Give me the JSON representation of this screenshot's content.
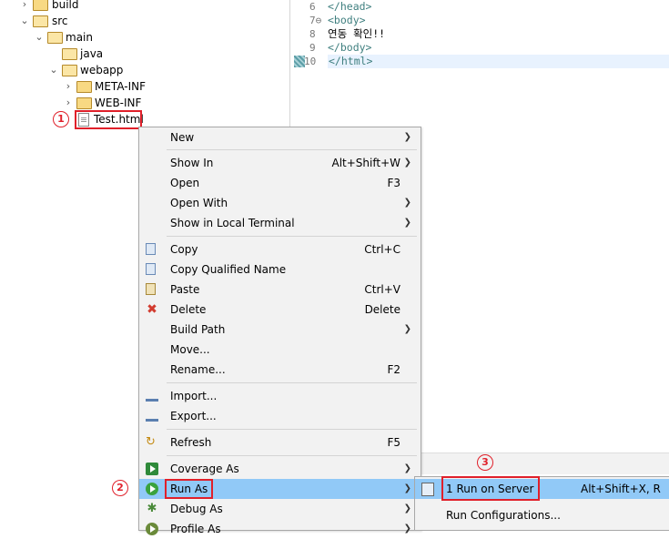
{
  "tree": {
    "items": [
      {
        "label": "build",
        "chevron": "›"
      },
      {
        "label": "src",
        "chevron": "⌄"
      },
      {
        "label": "main",
        "chevron": "⌄"
      },
      {
        "label": "java",
        "chevron": ""
      },
      {
        "label": "webapp",
        "chevron": "⌄"
      },
      {
        "label": "META-INF",
        "chevron": "›"
      },
      {
        "label": "WEB-INF",
        "chevron": "›"
      },
      {
        "label": "Test.html",
        "chevron": ""
      }
    ]
  },
  "editor": {
    "lines": [
      {
        "num": "6",
        "code": "</head>"
      },
      {
        "num": "7⊖",
        "code": "<body>"
      },
      {
        "num": "8",
        "code": "연동 확인!!"
      },
      {
        "num": "9",
        "code": "</body>"
      },
      {
        "num": "10",
        "code": "</html>"
      }
    ]
  },
  "menu": {
    "new": "New",
    "show_in": "Show In",
    "show_in_acc": "Alt+Shift+W",
    "open": "Open",
    "open_acc": "F3",
    "open_with": "Open With",
    "show_terminal": "Show in Local Terminal",
    "copy": "Copy",
    "copy_acc": "Ctrl+C",
    "copy_qualified": "Copy Qualified Name",
    "paste": "Paste",
    "paste_acc": "Ctrl+V",
    "delete": "Delete",
    "delete_acc": "Delete",
    "build_path": "Build Path",
    "move": "Move...",
    "rename": "Rename...",
    "rename_acc": "F2",
    "import": "Import...",
    "export": "Export...",
    "refresh": "Refresh",
    "refresh_acc": "F5",
    "coverage_as": "Coverage As",
    "run_as": "Run As",
    "debug_as": "Debug As",
    "profile_as": "Profile As"
  },
  "submenu": {
    "run_on_server": "1 Run on Server",
    "run_on_server_acc": "Alt+Shift+X, R",
    "run_configs": "Run Configurations..."
  },
  "steps": {
    "one": "1",
    "two": "2",
    "three": "3"
  },
  "colors": {
    "highlight": "#91c9f7",
    "annotation": "#e0202a",
    "menu_bg": "#f2f2f2"
  },
  "icons": {
    "submenu": "chevron-right-icon",
    "folder": "folder-icon",
    "file": "html-file-icon"
  }
}
